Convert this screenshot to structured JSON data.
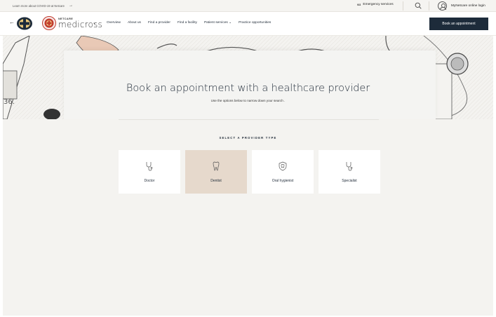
{
  "topbar": {
    "covid_text": "Learn more about COVID-19 at Netcare",
    "emergency_badge": "911",
    "emergency_label": "Emergency services",
    "login_label": "MyNetcare online login"
  },
  "nav": {
    "brand_small": "NETCARE",
    "brand_big": "medicross",
    "items": [
      "Overview",
      "About us",
      "Find a provider",
      "Find a facility",
      "Patient services",
      "Practice opportunities"
    ],
    "book_button": "Book an appointment"
  },
  "hero": {
    "title": "Book an appointment with a healthcare provider",
    "subtitle": "Use the options below to narrow down your search ."
  },
  "provider": {
    "section_label": "SELECT A PROVIDER TYPE",
    "types": [
      {
        "label": "Doctor",
        "icon": "stethoscope-icon",
        "selected": false
      },
      {
        "label": "Dentist",
        "icon": "tooth-icon",
        "selected": true
      },
      {
        "label": "Oral hygienist",
        "icon": "shield-tooth-icon",
        "selected": false
      },
      {
        "label": "Specialist",
        "icon": "stethoscope-icon",
        "selected": false
      }
    ]
  },
  "colors": {
    "primary": "#1d2b3a",
    "selected_card": "#e6d9cc",
    "background": "#f4f3f0"
  }
}
